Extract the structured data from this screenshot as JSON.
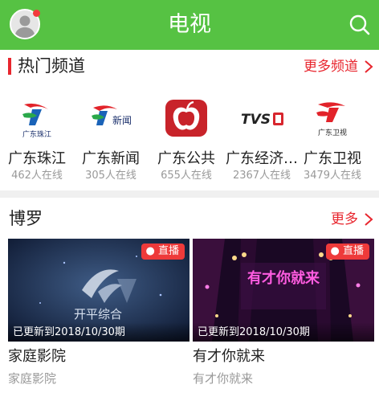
{
  "header": {
    "title": "电视",
    "avatar_icon": "user-avatar-icon",
    "notification_dot_color": "#f23b3b",
    "search_icon": "search-icon",
    "background_color": "#56c243"
  },
  "hot_channels": {
    "title": "热门频道",
    "more_label": "更多频道",
    "items": [
      {
        "name": "广东珠江",
        "online": "462人在线",
        "logo_text": "广东珠江"
      },
      {
        "name": "广东新闻",
        "online": "305人在线",
        "logo_text": "新闻"
      },
      {
        "name": "广东公共",
        "online": "655人在线",
        "logo_text": ""
      },
      {
        "name": "广东经济…",
        "online": "2367人在线",
        "logo_text": "TVS"
      },
      {
        "name": "广东卫视",
        "online": "3479人在线",
        "logo_text": "广东卫视"
      }
    ]
  },
  "boluo": {
    "title": "博罗",
    "more_label": "更多",
    "cards": [
      {
        "live_badge": "直播",
        "updated": "已更新到2018/10/30期",
        "title": "家庭影院",
        "subtitle": "家庭影院",
        "thumb_caption": "开平综合"
      },
      {
        "live_badge": "直播",
        "updated": "已更新到2018/10/30期",
        "title": "有才你就来",
        "subtitle": "有才你就来",
        "thumb_caption": "有才你就来"
      }
    ]
  },
  "accent_color": "#e8262e"
}
